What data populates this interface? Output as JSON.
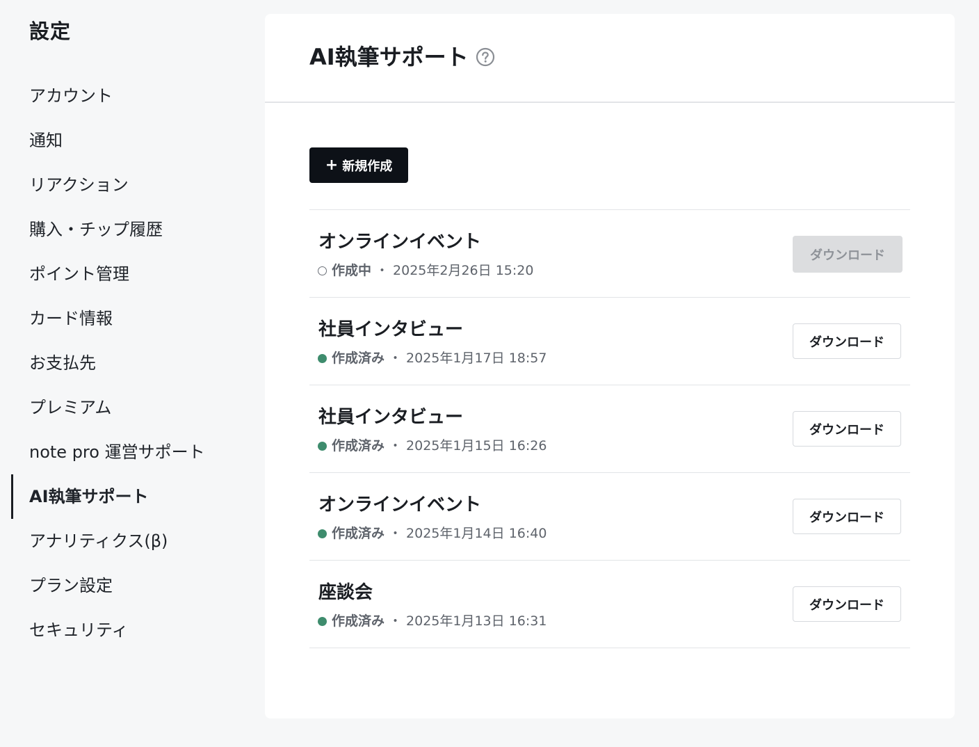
{
  "sidebar": {
    "title": "設定",
    "items": [
      {
        "label": "アカウント",
        "active": false
      },
      {
        "label": "通知",
        "active": false
      },
      {
        "label": "リアクション",
        "active": false
      },
      {
        "label": "購入・チップ履歴",
        "active": false
      },
      {
        "label": "ポイント管理",
        "active": false
      },
      {
        "label": "カード情報",
        "active": false
      },
      {
        "label": "お支払先",
        "active": false
      },
      {
        "label": "プレミアム",
        "active": false
      },
      {
        "label": "note pro 運営サポート",
        "active": false
      },
      {
        "label": "AI執筆サポート",
        "active": true
      },
      {
        "label": "アナリティクス(β)",
        "active": false
      },
      {
        "label": "プラン設定",
        "active": false
      },
      {
        "label": "セキュリティ",
        "active": false
      }
    ]
  },
  "main": {
    "title": "AI執筆サポート",
    "help_icon": "question-circle-icon",
    "new_button": {
      "icon": "+",
      "label": "新規作成"
    },
    "documents": [
      {
        "title": "オンラインイベント",
        "status": "作成中",
        "status_state": "pending",
        "separator": "・",
        "date": "2025年2月26日 15:20",
        "download_label": "ダウンロード",
        "download_enabled": false
      },
      {
        "title": "社員インタビュー",
        "status": "作成済み",
        "status_state": "done",
        "separator": "・",
        "date": "2025年1月17日 18:57",
        "download_label": "ダウンロード",
        "download_enabled": true
      },
      {
        "title": "社員インタビュー",
        "status": "作成済み",
        "status_state": "done",
        "separator": "・",
        "date": "2025年1月15日 16:26",
        "download_label": "ダウンロード",
        "download_enabled": true
      },
      {
        "title": "オンラインイベント",
        "status": "作成済み",
        "status_state": "done",
        "separator": "・",
        "date": "2025年1月14日 16:40",
        "download_label": "ダウンロード",
        "download_enabled": true
      },
      {
        "title": "座談会",
        "status": "作成済み",
        "status_state": "done",
        "separator": "・",
        "date": "2025年1月13日 16:31",
        "download_label": "ダウンロード",
        "download_enabled": true
      }
    ]
  },
  "colors": {
    "page_background": "#f6f7f8",
    "panel_background": "#ffffff",
    "primary_button": "#0d1117",
    "status_done": "#3e8c6d",
    "disabled_button": "#dcdddf"
  }
}
